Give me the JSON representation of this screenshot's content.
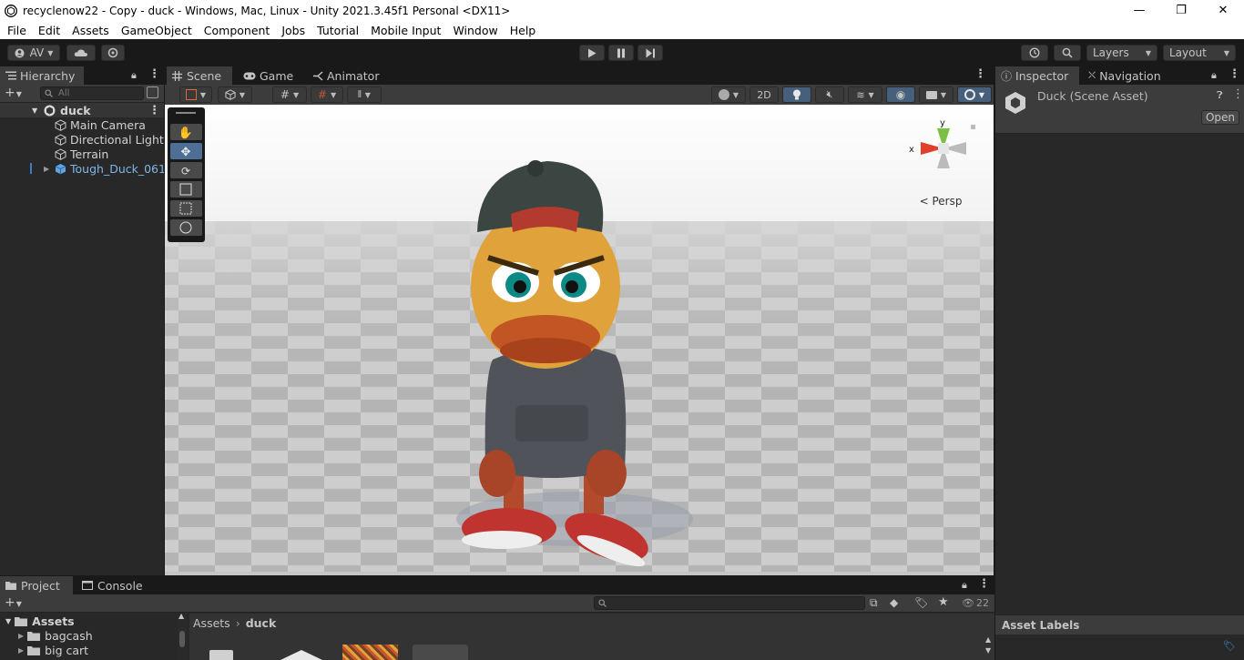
{
  "window": {
    "title": "recyclenow22 - Copy - duck - Windows, Mac, Linux - Unity 2021.3.45f1 Personal <DX11>",
    "minimize": "—",
    "maximize": "❐",
    "close": "✕"
  },
  "menu": [
    "File",
    "Edit",
    "Assets",
    "GameObject",
    "Component",
    "Jobs",
    "Tutorial",
    "Mobile Input",
    "Window",
    "Help"
  ],
  "toolbar": {
    "account_label": "AV",
    "layers_label": "Layers",
    "layout_label": "Layout"
  },
  "hierarchy": {
    "tab_label": "Hierarchy",
    "search_placeholder": "All",
    "scene_name": "duck",
    "items": [
      {
        "label": "Main Camera"
      },
      {
        "label": "Directional Light"
      },
      {
        "label": "Terrain"
      },
      {
        "label": "Tough_Duck_061"
      }
    ]
  },
  "scene_tabs": [
    {
      "label": "Scene"
    },
    {
      "label": "Game"
    },
    {
      "label": "Animator"
    }
  ],
  "scene": {
    "mode_2d": "2D",
    "gizmo": {
      "y": "y",
      "x": "x",
      "persp": "Persp"
    }
  },
  "inspector": {
    "tab_label": "Inspector",
    "nav_tab_label": "Navigation",
    "asset_title": "Duck (Scene Asset)",
    "open_button": "Open",
    "asset_labels": "Asset Labels"
  },
  "project": {
    "tab_label": "Project",
    "console_tab_label": "Console",
    "hidden_count": "22",
    "tree": [
      {
        "label": "Assets"
      },
      {
        "label": "bagcash"
      },
      {
        "label": "big cart"
      }
    ],
    "breadcrumb": [
      "Assets",
      "duck"
    ]
  },
  "colors": {
    "accent": "#2c5d87",
    "panel": "#282828",
    "header": "#191919",
    "active_tab": "#3c3c3c"
  }
}
